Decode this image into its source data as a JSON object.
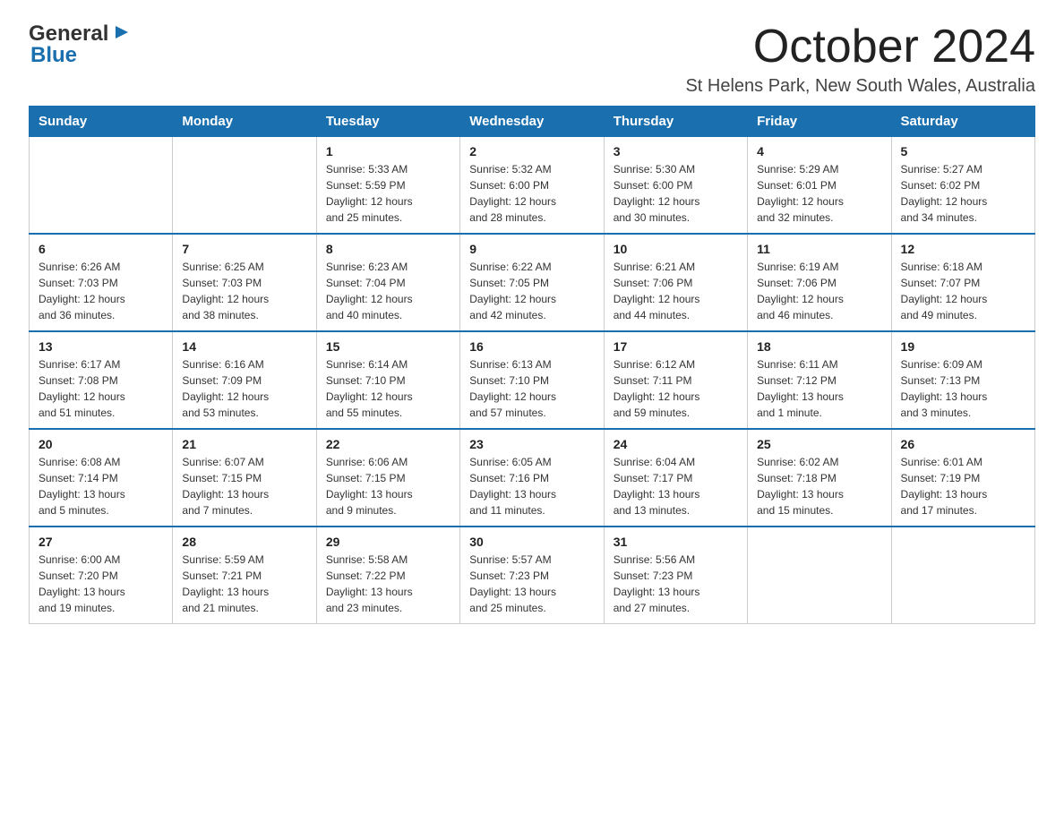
{
  "header": {
    "month_title": "October 2024",
    "location": "St Helens Park, New South Wales, Australia",
    "logo_general": "General",
    "logo_blue": "Blue"
  },
  "days_of_week": [
    "Sunday",
    "Monday",
    "Tuesday",
    "Wednesday",
    "Thursday",
    "Friday",
    "Saturday"
  ],
  "weeks": [
    [
      {
        "day": "",
        "info": ""
      },
      {
        "day": "",
        "info": ""
      },
      {
        "day": "1",
        "info": "Sunrise: 5:33 AM\nSunset: 5:59 PM\nDaylight: 12 hours\nand 25 minutes."
      },
      {
        "day": "2",
        "info": "Sunrise: 5:32 AM\nSunset: 6:00 PM\nDaylight: 12 hours\nand 28 minutes."
      },
      {
        "day": "3",
        "info": "Sunrise: 5:30 AM\nSunset: 6:00 PM\nDaylight: 12 hours\nand 30 minutes."
      },
      {
        "day": "4",
        "info": "Sunrise: 5:29 AM\nSunset: 6:01 PM\nDaylight: 12 hours\nand 32 minutes."
      },
      {
        "day": "5",
        "info": "Sunrise: 5:27 AM\nSunset: 6:02 PM\nDaylight: 12 hours\nand 34 minutes."
      }
    ],
    [
      {
        "day": "6",
        "info": "Sunrise: 6:26 AM\nSunset: 7:03 PM\nDaylight: 12 hours\nand 36 minutes."
      },
      {
        "day": "7",
        "info": "Sunrise: 6:25 AM\nSunset: 7:03 PM\nDaylight: 12 hours\nand 38 minutes."
      },
      {
        "day": "8",
        "info": "Sunrise: 6:23 AM\nSunset: 7:04 PM\nDaylight: 12 hours\nand 40 minutes."
      },
      {
        "day": "9",
        "info": "Sunrise: 6:22 AM\nSunset: 7:05 PM\nDaylight: 12 hours\nand 42 minutes."
      },
      {
        "day": "10",
        "info": "Sunrise: 6:21 AM\nSunset: 7:06 PM\nDaylight: 12 hours\nand 44 minutes."
      },
      {
        "day": "11",
        "info": "Sunrise: 6:19 AM\nSunset: 7:06 PM\nDaylight: 12 hours\nand 46 minutes."
      },
      {
        "day": "12",
        "info": "Sunrise: 6:18 AM\nSunset: 7:07 PM\nDaylight: 12 hours\nand 49 minutes."
      }
    ],
    [
      {
        "day": "13",
        "info": "Sunrise: 6:17 AM\nSunset: 7:08 PM\nDaylight: 12 hours\nand 51 minutes."
      },
      {
        "day": "14",
        "info": "Sunrise: 6:16 AM\nSunset: 7:09 PM\nDaylight: 12 hours\nand 53 minutes."
      },
      {
        "day": "15",
        "info": "Sunrise: 6:14 AM\nSunset: 7:10 PM\nDaylight: 12 hours\nand 55 minutes."
      },
      {
        "day": "16",
        "info": "Sunrise: 6:13 AM\nSunset: 7:10 PM\nDaylight: 12 hours\nand 57 minutes."
      },
      {
        "day": "17",
        "info": "Sunrise: 6:12 AM\nSunset: 7:11 PM\nDaylight: 12 hours\nand 59 minutes."
      },
      {
        "day": "18",
        "info": "Sunrise: 6:11 AM\nSunset: 7:12 PM\nDaylight: 13 hours\nand 1 minute."
      },
      {
        "day": "19",
        "info": "Sunrise: 6:09 AM\nSunset: 7:13 PM\nDaylight: 13 hours\nand 3 minutes."
      }
    ],
    [
      {
        "day": "20",
        "info": "Sunrise: 6:08 AM\nSunset: 7:14 PM\nDaylight: 13 hours\nand 5 minutes."
      },
      {
        "day": "21",
        "info": "Sunrise: 6:07 AM\nSunset: 7:15 PM\nDaylight: 13 hours\nand 7 minutes."
      },
      {
        "day": "22",
        "info": "Sunrise: 6:06 AM\nSunset: 7:15 PM\nDaylight: 13 hours\nand 9 minutes."
      },
      {
        "day": "23",
        "info": "Sunrise: 6:05 AM\nSunset: 7:16 PM\nDaylight: 13 hours\nand 11 minutes."
      },
      {
        "day": "24",
        "info": "Sunrise: 6:04 AM\nSunset: 7:17 PM\nDaylight: 13 hours\nand 13 minutes."
      },
      {
        "day": "25",
        "info": "Sunrise: 6:02 AM\nSunset: 7:18 PM\nDaylight: 13 hours\nand 15 minutes."
      },
      {
        "day": "26",
        "info": "Sunrise: 6:01 AM\nSunset: 7:19 PM\nDaylight: 13 hours\nand 17 minutes."
      }
    ],
    [
      {
        "day": "27",
        "info": "Sunrise: 6:00 AM\nSunset: 7:20 PM\nDaylight: 13 hours\nand 19 minutes."
      },
      {
        "day": "28",
        "info": "Sunrise: 5:59 AM\nSunset: 7:21 PM\nDaylight: 13 hours\nand 21 minutes."
      },
      {
        "day": "29",
        "info": "Sunrise: 5:58 AM\nSunset: 7:22 PM\nDaylight: 13 hours\nand 23 minutes."
      },
      {
        "day": "30",
        "info": "Sunrise: 5:57 AM\nSunset: 7:23 PM\nDaylight: 13 hours\nand 25 minutes."
      },
      {
        "day": "31",
        "info": "Sunrise: 5:56 AM\nSunset: 7:23 PM\nDaylight: 13 hours\nand 27 minutes."
      },
      {
        "day": "",
        "info": ""
      },
      {
        "day": "",
        "info": ""
      }
    ]
  ]
}
